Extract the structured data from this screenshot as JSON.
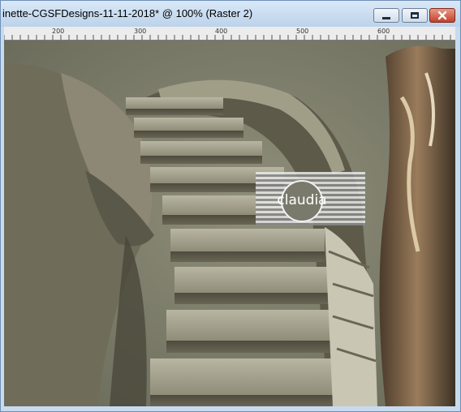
{
  "window": {
    "title": "inette-CGSFDesigns-11-11-2018* @ 100% (Raster 2)",
    "controls": {
      "minimize_icon": "minimize-icon",
      "maximize_icon": "maximize-icon",
      "close_icon": "close-icon"
    }
  },
  "ruler": {
    "labels": [
      "200",
      "300",
      "400",
      "500",
      "600"
    ]
  },
  "canvas": {
    "image_subject": "stone-staircase-artwork",
    "watermark": {
      "text": "claudia"
    }
  },
  "colors": {
    "titlebar": "#c7dbef",
    "close_button": "#c4412b",
    "canvas_tone": "#80806e"
  }
}
